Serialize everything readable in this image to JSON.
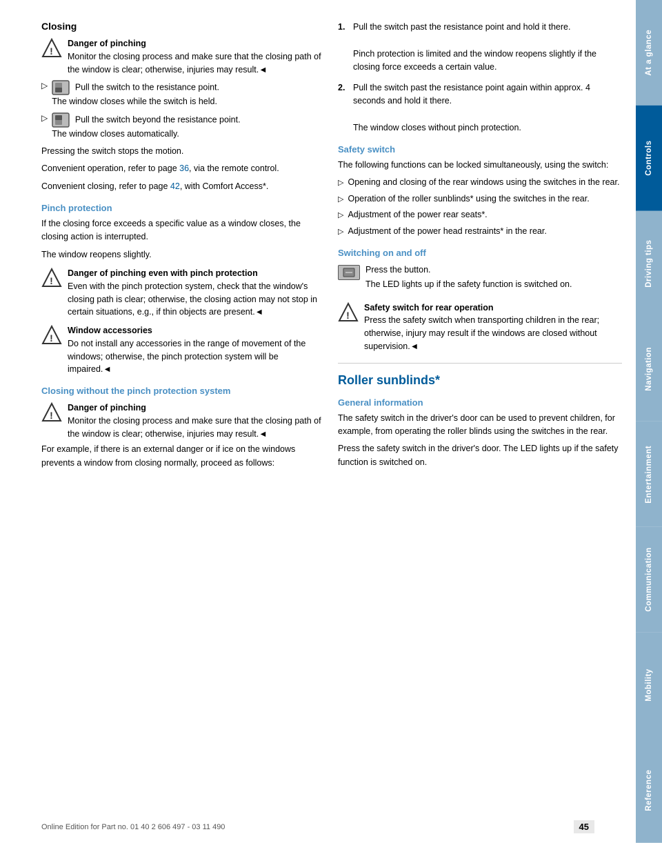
{
  "sidebar": {
    "tabs": [
      {
        "label": "At a glance",
        "active": false
      },
      {
        "label": "Controls",
        "active": true
      },
      {
        "label": "Driving tips",
        "active": false
      },
      {
        "label": "Navigation",
        "active": false
      },
      {
        "label": "Entertainment",
        "active": false
      },
      {
        "label": "Communication",
        "active": false
      },
      {
        "label": "Mobility",
        "active": false
      },
      {
        "label": "Reference",
        "active": false
      }
    ]
  },
  "page": {
    "number": "45",
    "footer_text": "Online Edition for Part no. 01 40 2 606 497 - 03 11 490"
  },
  "left_col": {
    "main_heading": "Closing",
    "warning1": {
      "title": "Danger of pinching",
      "body": "Monitor the closing process and make sure that the closing path of the window is clear; otherwise, injuries may result.◄"
    },
    "arrow_item1": {
      "switch_label": "",
      "text_main": "Pull the switch to the resistance point.",
      "text_sub": "The window closes while the switch is held."
    },
    "arrow_item2": {
      "text_main": "Pull the switch beyond the resistance point.",
      "text_sub": "The window closes automatically."
    },
    "pressing_text": "Pressing the switch stops the motion.",
    "convenient_text1": "Convenient operation, refer to page 36, via the remote control.",
    "page_ref1": "36",
    "convenient_text2": "Convenient closing, refer to page 42, with Comfort Access*.",
    "page_ref2": "42",
    "pinch_heading": "Pinch protection",
    "pinch_text1": "If the closing force exceeds a specific value as a window closes, the closing action is interrupted.",
    "pinch_text2": "The window reopens slightly.",
    "warning_pinch": {
      "title": "Danger of pinching even with pinch protection",
      "body": "Even with the pinch protection system, check that the window's closing path is clear; otherwise, the closing action may not stop in certain situations, e.g., if thin objects are present.◄"
    },
    "warning_accessories": {
      "title": "Window accessories",
      "body": "Do not install any accessories in the range of movement of the windows; otherwise, the pinch protection system will be impaired.◄"
    },
    "closing_without_heading": "Closing without the pinch protection system",
    "warning_closing_without": {
      "title": "Danger of pinching",
      "body": "Monitor the closing process and make sure that the closing path of the window is clear; otherwise, injuries may result.◄"
    },
    "for_example_text": "For example, if there is an external danger or if ice on the windows prevents a window from closing normally, proceed as follows:"
  },
  "right_col": {
    "steps": [
      {
        "num": "1.",
        "text": "Pull the switch past the resistance point and hold it there.",
        "sub": "Pinch protection is limited and the window reopens slightly if the closing force exceeds a certain value."
      },
      {
        "num": "2.",
        "text": "Pull the switch past the resistance point again within approx. 4 seconds and hold it there.",
        "sub": "The window closes without pinch protection."
      }
    ],
    "safety_switch_heading": "Safety switch",
    "safety_switch_text1": "The following functions can be locked simultaneously, using the switch:",
    "safety_switch_items": [
      "Opening and closing of the rear windows using the switches in the rear.",
      "Operation of the roller sunblinds* using the switches in the rear.",
      "Adjustment of the power rear seats*.",
      "Adjustment of the power head restraints* in the rear."
    ],
    "switching_heading": "Switching on and off",
    "switching_text1": "Press the button.",
    "switching_text2": "The LED lights up if the safety function is switched on.",
    "warning_safety": {
      "title": "Safety switch for rear operation",
      "body": "Press the safety switch when transporting children in the rear; otherwise, injury may result if the windows are closed without supervision.◄"
    },
    "roller_heading": "Roller sunblinds*",
    "general_info_heading": "General information",
    "general_info_text1": "The safety switch in the driver's door can be used to prevent children, for example, from operating the roller blinds using the switches in the rear.",
    "general_info_text2": "Press the safety switch in the driver's door. The LED lights up if the safety function is switched on."
  }
}
